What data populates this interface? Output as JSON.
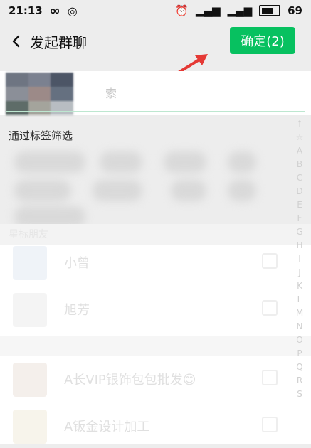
{
  "status": {
    "time": "21:13",
    "icons": [
      "infinity-icon",
      "nfc-icon",
      "alarm-icon",
      "signal-icon",
      "signal-icon-2",
      "battery-icon"
    ],
    "battery": "69"
  },
  "nav": {
    "title": "发起群聊",
    "confirm_label": "确定(2)"
  },
  "search": {
    "partial_text": "索"
  },
  "filter_label": "通过标签筛选",
  "section_header": "星标朋友",
  "contacts": [
    {
      "name": "小曾",
      "checked": false
    },
    {
      "name": "旭芳",
      "checked": false
    },
    {
      "name": "A长VIP银饰包包批发😊",
      "checked": false
    },
    {
      "name": "A钣金设计加工",
      "checked": false
    }
  ],
  "alphabet": [
    "↑",
    "☆",
    "A",
    "B",
    "C",
    "D",
    "E",
    "F",
    "G",
    "H",
    "I",
    "J",
    "K",
    "L",
    "M",
    "N",
    "O",
    "P",
    "Q",
    "R",
    "S"
  ]
}
